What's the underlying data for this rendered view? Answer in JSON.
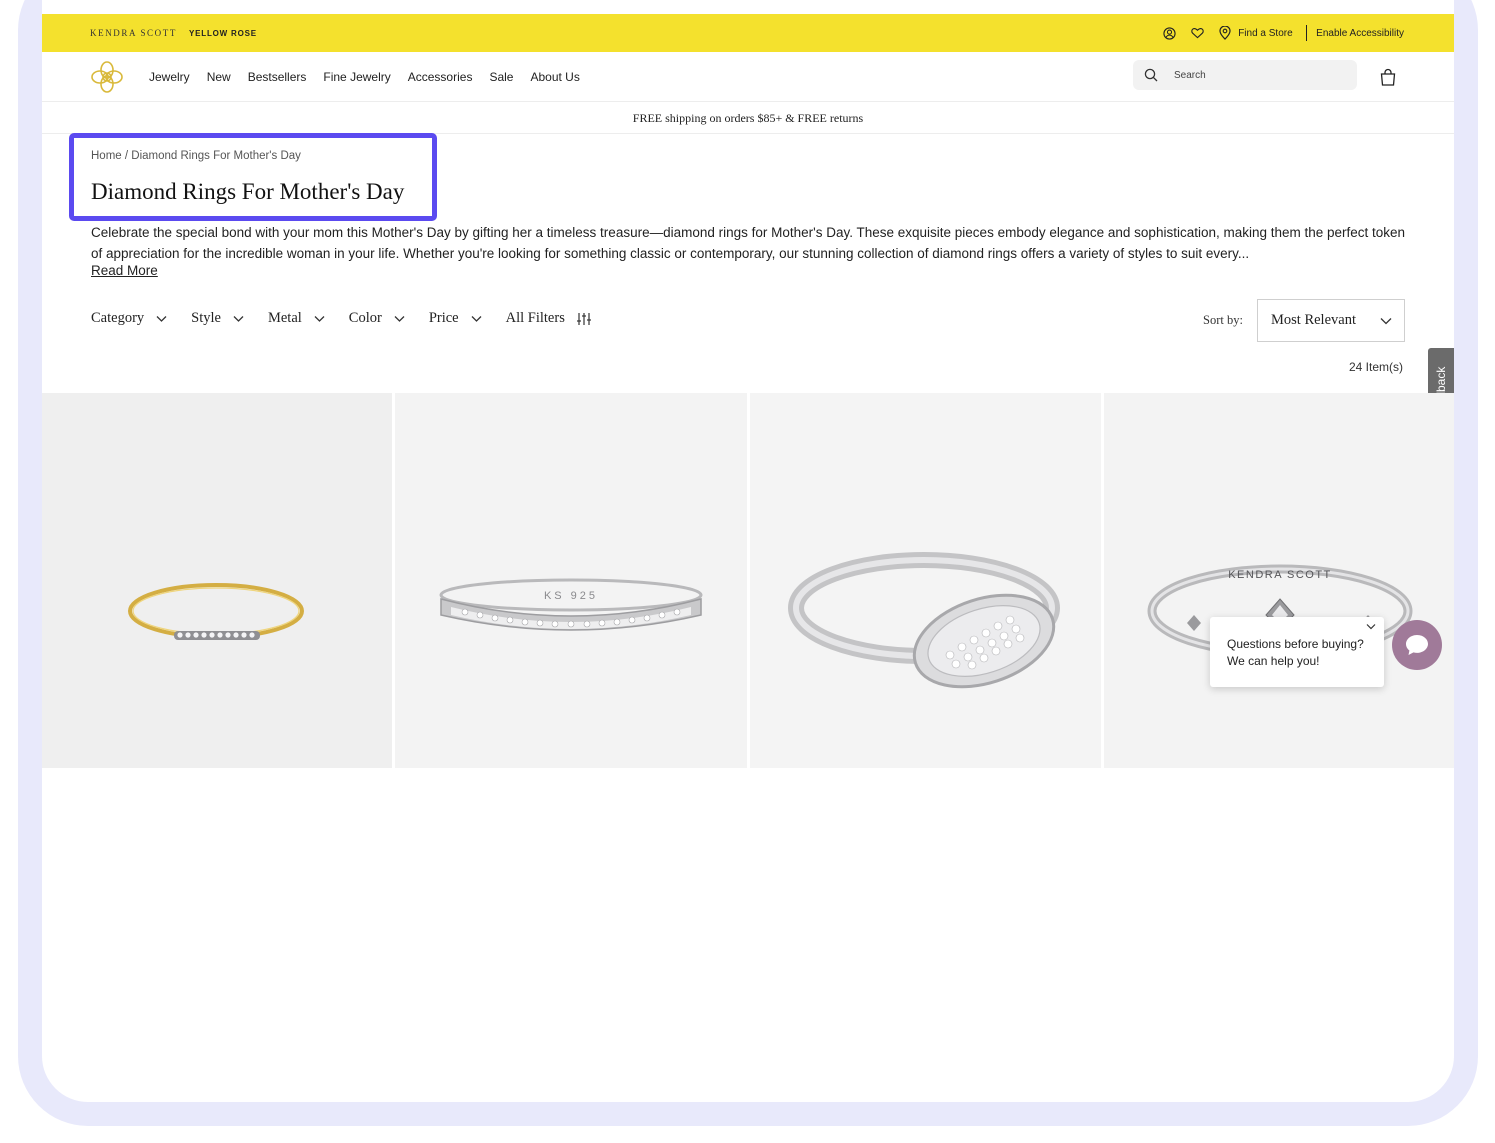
{
  "topbar": {
    "brand_primary": "KENDRA SCOTT",
    "brand_secondary": "YELLOW ROSE",
    "find_store": "Find a Store",
    "accessibility": "Enable Accessibility"
  },
  "nav": {
    "items": [
      {
        "label": "Jewelry"
      },
      {
        "label": "New"
      },
      {
        "label": "Bestsellers"
      },
      {
        "label": "Fine Jewelry"
      },
      {
        "label": "Accessories"
      },
      {
        "label": "Sale"
      },
      {
        "label": "About Us"
      }
    ],
    "search_placeholder": "Search"
  },
  "promo": {
    "shipping": "FREE shipping on orders $85+ & FREE returns"
  },
  "page": {
    "breadcrumb": "Home / Diamond Rings For Mother's Day",
    "title": "Diamond Rings For Mother's Day",
    "description": "Celebrate the special bond with your mom this Mother's Day by gifting her a timeless treasure—diamond rings for Mother's Day. These exquisite pieces embody elegance and sophistication, making them the perfect token of appreciation for the incredible woman in your life. Whether you're looking for something classic or contemporary, our stunning collection of diamond rings offers a variety of styles to suit every...",
    "read_more": "Read More"
  },
  "filters": {
    "items": [
      {
        "label": "Category"
      },
      {
        "label": "Style"
      },
      {
        "label": "Metal"
      },
      {
        "label": "Color"
      },
      {
        "label": "Price"
      }
    ],
    "all_filters": "All Filters",
    "sort_label": "Sort by:",
    "sort_value": "Most Relevant",
    "items_count": "24 Item(s)"
  },
  "feedback": {
    "label": "Feedback"
  },
  "products": {
    "ring3_engraving": "KS 925",
    "ring4_engraving": "KENDRA SCOTT"
  },
  "chat": {
    "message": "Questions before buying? We can help you!"
  },
  "colors": {
    "topbar": "#f4e12d",
    "highlight": "#5b4af0",
    "chat_button": "#a07a99",
    "frame": "#e8e9fb"
  }
}
